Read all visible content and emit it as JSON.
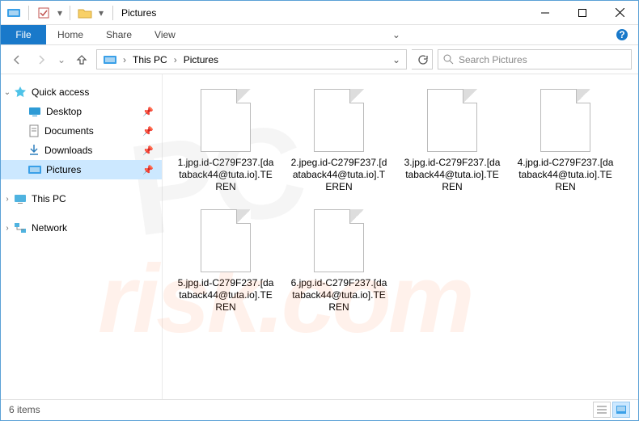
{
  "title": "Pictures",
  "ribbon": {
    "file": "File",
    "tabs": [
      "Home",
      "Share",
      "View"
    ]
  },
  "breadcrumb": {
    "root": "This PC",
    "current": "Pictures"
  },
  "search": {
    "placeholder": "Search Pictures"
  },
  "nav": {
    "quick": "Quick access",
    "items": [
      {
        "label": "Desktop",
        "pinned": true
      },
      {
        "label": "Documents",
        "pinned": true
      },
      {
        "label": "Downloads",
        "pinned": true
      },
      {
        "label": "Pictures",
        "pinned": true,
        "selected": true
      }
    ],
    "thispc": "This PC",
    "network": "Network"
  },
  "files": [
    {
      "name": "1.jpg.id-C279F237.[databack44@tuta.io].TEREN"
    },
    {
      "name": "2.jpeg.id-C279F237.[databack44@tuta.io].TEREN"
    },
    {
      "name": "3.jpg.id-C279F237.[databack44@tuta.io].TEREN"
    },
    {
      "name": "4.jpg.id-C279F237.[databack44@tuta.io].TEREN"
    },
    {
      "name": "5.jpg.id-C279F237.[databack44@tuta.io].TEREN"
    },
    {
      "name": "6.jpg.id-C279F237.[databack44@tuta.io].TEREN"
    }
  ],
  "status": {
    "count": "6 items"
  }
}
